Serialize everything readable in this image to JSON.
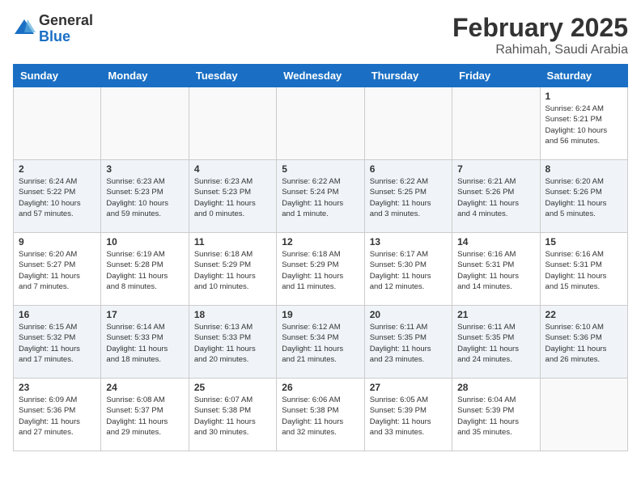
{
  "logo": {
    "general": "General",
    "blue": "Blue"
  },
  "title": {
    "month_year": "February 2025",
    "location": "Rahimah, Saudi Arabia"
  },
  "weekdays": [
    "Sunday",
    "Monday",
    "Tuesday",
    "Wednesday",
    "Thursday",
    "Friday",
    "Saturday"
  ],
  "weeks": [
    [
      {
        "day": "",
        "info": ""
      },
      {
        "day": "",
        "info": ""
      },
      {
        "day": "",
        "info": ""
      },
      {
        "day": "",
        "info": ""
      },
      {
        "day": "",
        "info": ""
      },
      {
        "day": "",
        "info": ""
      },
      {
        "day": "1",
        "info": "Sunrise: 6:24 AM\nSunset: 5:21 PM\nDaylight: 10 hours\nand 56 minutes."
      }
    ],
    [
      {
        "day": "2",
        "info": "Sunrise: 6:24 AM\nSunset: 5:22 PM\nDaylight: 10 hours\nand 57 minutes."
      },
      {
        "day": "3",
        "info": "Sunrise: 6:23 AM\nSunset: 5:23 PM\nDaylight: 10 hours\nand 59 minutes."
      },
      {
        "day": "4",
        "info": "Sunrise: 6:23 AM\nSunset: 5:23 PM\nDaylight: 11 hours\nand 0 minutes."
      },
      {
        "day": "5",
        "info": "Sunrise: 6:22 AM\nSunset: 5:24 PM\nDaylight: 11 hours\nand 1 minute."
      },
      {
        "day": "6",
        "info": "Sunrise: 6:22 AM\nSunset: 5:25 PM\nDaylight: 11 hours\nand 3 minutes."
      },
      {
        "day": "7",
        "info": "Sunrise: 6:21 AM\nSunset: 5:26 PM\nDaylight: 11 hours\nand 4 minutes."
      },
      {
        "day": "8",
        "info": "Sunrise: 6:20 AM\nSunset: 5:26 PM\nDaylight: 11 hours\nand 5 minutes."
      }
    ],
    [
      {
        "day": "9",
        "info": "Sunrise: 6:20 AM\nSunset: 5:27 PM\nDaylight: 11 hours\nand 7 minutes."
      },
      {
        "day": "10",
        "info": "Sunrise: 6:19 AM\nSunset: 5:28 PM\nDaylight: 11 hours\nand 8 minutes."
      },
      {
        "day": "11",
        "info": "Sunrise: 6:18 AM\nSunset: 5:29 PM\nDaylight: 11 hours\nand 10 minutes."
      },
      {
        "day": "12",
        "info": "Sunrise: 6:18 AM\nSunset: 5:29 PM\nDaylight: 11 hours\nand 11 minutes."
      },
      {
        "day": "13",
        "info": "Sunrise: 6:17 AM\nSunset: 5:30 PM\nDaylight: 11 hours\nand 12 minutes."
      },
      {
        "day": "14",
        "info": "Sunrise: 6:16 AM\nSunset: 5:31 PM\nDaylight: 11 hours\nand 14 minutes."
      },
      {
        "day": "15",
        "info": "Sunrise: 6:16 AM\nSunset: 5:31 PM\nDaylight: 11 hours\nand 15 minutes."
      }
    ],
    [
      {
        "day": "16",
        "info": "Sunrise: 6:15 AM\nSunset: 5:32 PM\nDaylight: 11 hours\nand 17 minutes."
      },
      {
        "day": "17",
        "info": "Sunrise: 6:14 AM\nSunset: 5:33 PM\nDaylight: 11 hours\nand 18 minutes."
      },
      {
        "day": "18",
        "info": "Sunrise: 6:13 AM\nSunset: 5:33 PM\nDaylight: 11 hours\nand 20 minutes."
      },
      {
        "day": "19",
        "info": "Sunrise: 6:12 AM\nSunset: 5:34 PM\nDaylight: 11 hours\nand 21 minutes."
      },
      {
        "day": "20",
        "info": "Sunrise: 6:11 AM\nSunset: 5:35 PM\nDaylight: 11 hours\nand 23 minutes."
      },
      {
        "day": "21",
        "info": "Sunrise: 6:11 AM\nSunset: 5:35 PM\nDaylight: 11 hours\nand 24 minutes."
      },
      {
        "day": "22",
        "info": "Sunrise: 6:10 AM\nSunset: 5:36 PM\nDaylight: 11 hours\nand 26 minutes."
      }
    ],
    [
      {
        "day": "23",
        "info": "Sunrise: 6:09 AM\nSunset: 5:36 PM\nDaylight: 11 hours\nand 27 minutes."
      },
      {
        "day": "24",
        "info": "Sunrise: 6:08 AM\nSunset: 5:37 PM\nDaylight: 11 hours\nand 29 minutes."
      },
      {
        "day": "25",
        "info": "Sunrise: 6:07 AM\nSunset: 5:38 PM\nDaylight: 11 hours\nand 30 minutes."
      },
      {
        "day": "26",
        "info": "Sunrise: 6:06 AM\nSunset: 5:38 PM\nDaylight: 11 hours\nand 32 minutes."
      },
      {
        "day": "27",
        "info": "Sunrise: 6:05 AM\nSunset: 5:39 PM\nDaylight: 11 hours\nand 33 minutes."
      },
      {
        "day": "28",
        "info": "Sunrise: 6:04 AM\nSunset: 5:39 PM\nDaylight: 11 hours\nand 35 minutes."
      },
      {
        "day": "",
        "info": ""
      }
    ]
  ]
}
